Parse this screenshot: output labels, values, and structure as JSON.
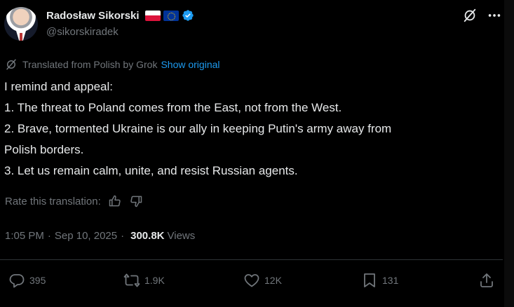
{
  "author": {
    "display_name": "Radosław Sikorski",
    "handle": "@sikorskiradek"
  },
  "translation": {
    "notice": "Translated from Polish by Grok",
    "show_original": "Show original",
    "rate_label": "Rate this translation:"
  },
  "tweet": {
    "lines": [
      "I remind and appeal:",
      "1. The threat to Poland comes from the East, not from the West.",
      "2. Brave, tormented Ukraine is our ally in keeping Putin's army away from",
      "Polish borders.",
      "3. Let us remain calm, unite, and resist Russian agents."
    ]
  },
  "meta": {
    "time": "1:05 PM",
    "separator": "·",
    "date": "Sep 10, 2025",
    "views_count": "300.8K",
    "views_label": "Views"
  },
  "actions": {
    "replies": "395",
    "reposts": "1.9K",
    "likes": "12K",
    "bookmarks": "131"
  },
  "icons": {
    "verified": "verified-badge-icon",
    "grok": "grok-icon",
    "reply": "reply-icon",
    "repost": "repost-icon",
    "like": "heart-icon",
    "bookmark": "bookmark-icon",
    "share": "share-icon",
    "thumbs_up": "thumbs-up-icon",
    "thumbs_down": "thumbs-down-icon"
  },
  "colors": {
    "background": "#000000",
    "text": "#e7e9ea",
    "muted": "#71767b",
    "accent": "#1d9bf0"
  }
}
